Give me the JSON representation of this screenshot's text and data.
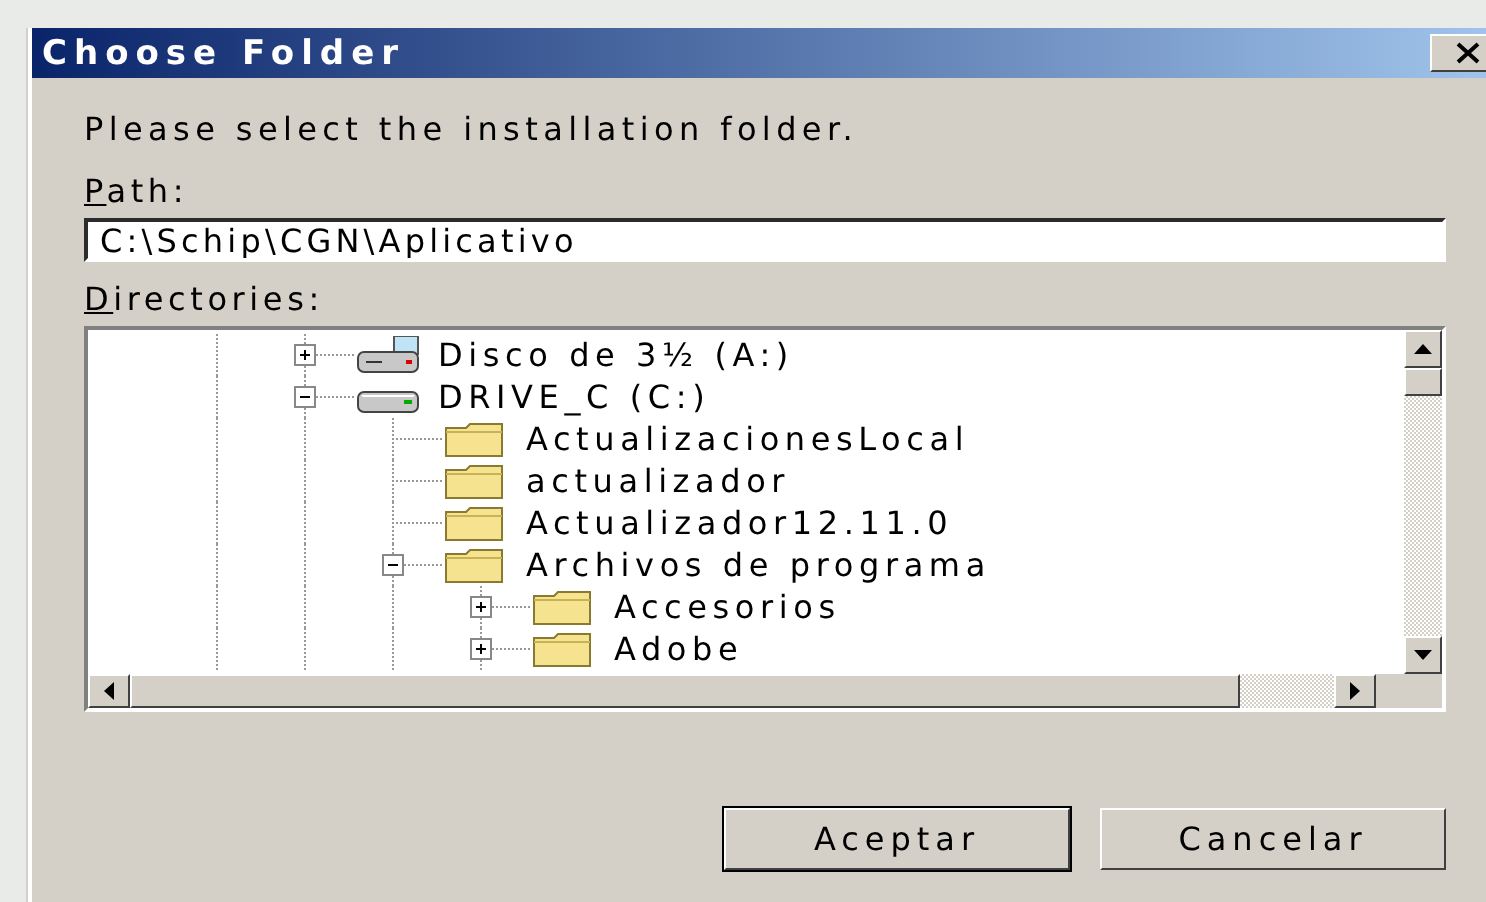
{
  "window": {
    "title": "Choose Folder"
  },
  "prompt": "Please select the installation folder.",
  "path": {
    "label": "Path:",
    "value": "C:\\Schip\\CGN\\Aplicativo"
  },
  "directories": {
    "label": "Directories:",
    "tree": [
      {
        "label": "Disco de 3½ (A:)",
        "kind": "floppy",
        "has_children": true,
        "expanded": false
      },
      {
        "label": "DRIVE_C (C:)",
        "kind": "drive",
        "has_children": true,
        "expanded": true,
        "children": [
          {
            "label": "ActualizacionesLocal",
            "kind": "folder",
            "has_children": false,
            "expanded": false
          },
          {
            "label": "actualizador",
            "kind": "folder",
            "has_children": false,
            "expanded": false
          },
          {
            "label": "Actualizador12.11.0",
            "kind": "folder",
            "has_children": false,
            "expanded": false
          },
          {
            "label": "Archivos de programa",
            "kind": "folder",
            "has_children": true,
            "expanded": true,
            "children": [
              {
                "label": "Accesorios",
                "kind": "folder",
                "has_children": true,
                "expanded": false
              },
              {
                "label": "Adobe",
                "kind": "folder",
                "has_children": true,
                "expanded": false
              }
            ]
          }
        ]
      }
    ]
  },
  "buttons": [
    {
      "label": "Aceptar",
      "default": true
    },
    {
      "label": "Cancelar",
      "default": false
    }
  ]
}
